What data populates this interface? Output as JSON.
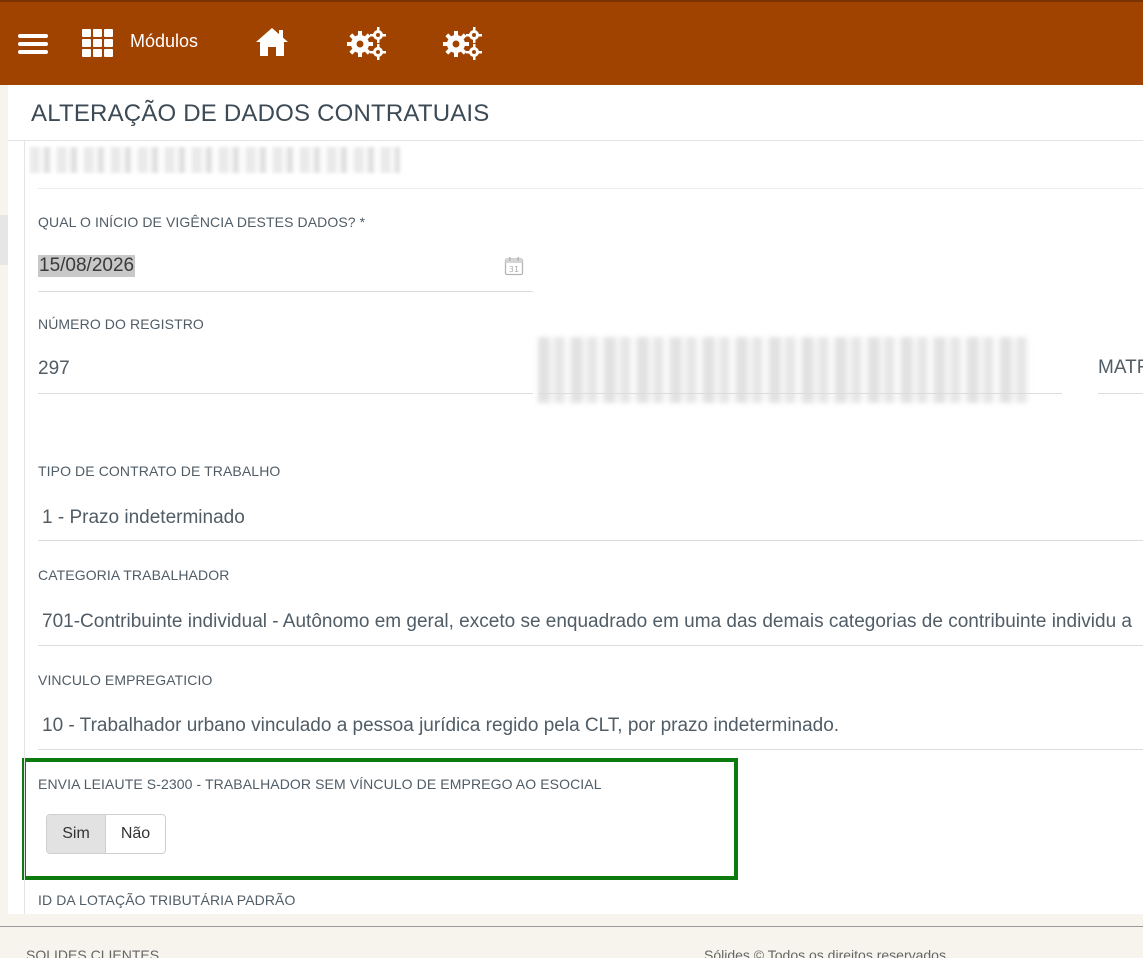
{
  "topbar": {
    "modules_label": "Módulos",
    "color": "#a14300"
  },
  "page": {
    "title": "ALTERAÇÃO DE DADOS CONTRATUAIS"
  },
  "fields": {
    "vigencia": {
      "label": "QUAL O INÍCIO DE VIGÊNCIA DESTES DADOS? *",
      "value": "15/08/2026",
      "icon": "calendar-icon"
    },
    "registro": {
      "label": "NÚMERO DO REGISTRO",
      "value": "297"
    },
    "matricula_partial": "MATR",
    "tipo_contrato": {
      "label": "TIPO DE CONTRATO DE TRABALHO",
      "value": "1 - Prazo indeterminado"
    },
    "categoria": {
      "label": "CATEGORIA TRABALHADOR",
      "value": "701-Contribuinte individual - Autônomo em geral, exceto se enquadrado em uma das demais categorias de contribuinte individu a"
    },
    "vinculo": {
      "label": "VINCULO EMPREGATICIO",
      "value": "10 - Trabalhador urbano vinculado a pessoa jurídica regido pela CLT, por prazo indeterminado."
    },
    "s2300": {
      "label": "ENVIA LEIAUTE S-2300 - TRABALHADOR SEM VÍNCULO DE EMPREGO AO ESOCIAL",
      "options": [
        "Sim",
        "Não"
      ],
      "selected": "Sim",
      "highlight_color": "#0d7a0d"
    },
    "lotacao": {
      "label": "ID DA LOTAÇÃO TRIBUTÁRIA PADRÃO"
    }
  },
  "footer": {
    "left": "SOLIDES CLIENTES",
    "right": "Sólides © Todos os direitos reservados"
  }
}
